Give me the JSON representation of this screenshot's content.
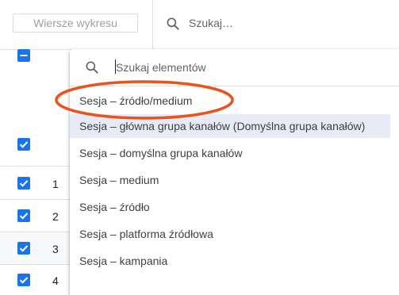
{
  "toolbar": {
    "rows_button_label": "Wiersze wykresu",
    "search_label": "Szukaj…"
  },
  "table": {
    "rows": [
      {
        "number": "1"
      },
      {
        "number": "2"
      },
      {
        "number": "3"
      },
      {
        "number": "4"
      }
    ]
  },
  "dropdown": {
    "search_placeholder": "Szukaj elementów",
    "items": [
      {
        "label": "Sesja – źródło/medium",
        "circled": true
      },
      {
        "label": "Sesja – główna grupa kanałów (Domyślna grupa kanałów)",
        "highlighted": true
      },
      {
        "label": "Sesja – domyślna grupa kanałów"
      },
      {
        "label": "Sesja – medium"
      },
      {
        "label": "Sesja – źródło"
      },
      {
        "label": "Sesja – platforma źródłowa"
      },
      {
        "label": "Sesja – kampania"
      }
    ]
  },
  "colors": {
    "accent": "#1a73e8",
    "annotation_circle": "#e8541c",
    "highlight_row": "#e8eaf6"
  }
}
